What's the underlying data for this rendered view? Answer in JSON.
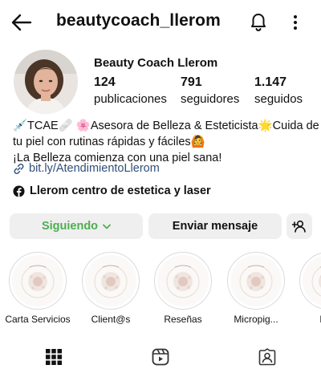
{
  "header": {
    "username": "beautycoach_llerom",
    "back_icon": "arrow-left-icon",
    "bell_icon": "bell-icon",
    "more_icon": "vertical-dots-icon"
  },
  "profile": {
    "display_name": "Beauty Coach Llerom",
    "stats": {
      "posts": {
        "value": "124",
        "label": "publicaciones"
      },
      "followers": {
        "value": "791",
        "label": "seguidores"
      },
      "following": {
        "value": "1.147",
        "label": "seguidos"
      }
    },
    "bio_lines": [
      "💉TCAE🩹 🌸Asesora de Belleza & Esteticista🌟Cuida de",
      "tu piel con rutinas rápidas y fáciles🙆",
      "¡La Belleza comienza con una piel sana!"
    ],
    "link": {
      "icon": "link-icon",
      "text": "bit.ly/AtendimientoLlerom"
    },
    "facebook": {
      "icon": "facebook-icon",
      "text": "Llerom centro de estetica y laser"
    }
  },
  "actions": {
    "following_label": "Siguiendo",
    "message_label": "Enviar mensaje",
    "add_user_icon": "add-user-icon",
    "accent_color": "#4caf50"
  },
  "highlights": [
    {
      "label": "Carta Servicios"
    },
    {
      "label": "Client@s"
    },
    {
      "label": "Reseñas"
    },
    {
      "label": "Micropig..."
    },
    {
      "label": "Nov"
    }
  ],
  "tabs": [
    {
      "name": "grid",
      "icon": "grid-icon"
    },
    {
      "name": "reels",
      "icon": "reels-icon"
    },
    {
      "name": "tagged",
      "icon": "tagged-user-icon"
    }
  ]
}
